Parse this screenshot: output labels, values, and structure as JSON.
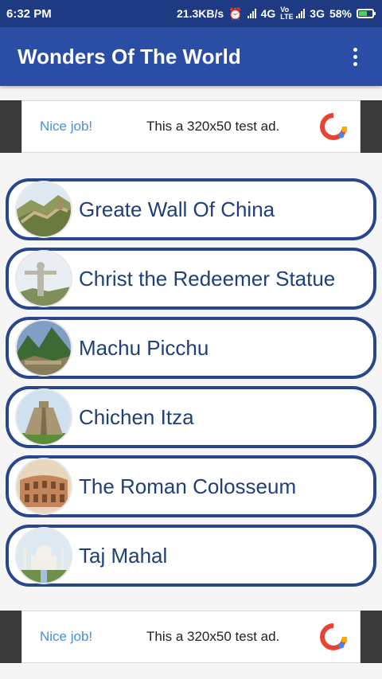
{
  "status_bar": {
    "time": "6:32 PM",
    "network_speed": "21.3KB/s",
    "network_4g": "4G",
    "volte": "Vo LTE",
    "network_3g": "3G",
    "battery": "58%"
  },
  "app_bar": {
    "title": "Wonders Of The World"
  },
  "ads": [
    {
      "nice": "Nice job!",
      "text": "This a 320x50 test ad."
    },
    {
      "nice": "Nice job!",
      "text": "This a 320x50 test ad."
    }
  ],
  "wonders": [
    {
      "label": "Greate Wall Of China",
      "icon": "great-wall-icon"
    },
    {
      "label": "Christ the Redeemer Statue",
      "icon": "christ-redeemer-icon"
    },
    {
      "label": "Machu Picchu",
      "icon": "machu-picchu-icon"
    },
    {
      "label": "Chichen Itza",
      "icon": "chichen-itza-icon"
    },
    {
      "label": "The Roman Colosseum",
      "icon": "colosseum-icon"
    },
    {
      "label": "Taj Mahal",
      "icon": "taj-mahal-icon"
    }
  ],
  "colors": {
    "status_bar": "#1e3a82",
    "app_bar": "#2a4ea6",
    "card_border": "#28468d",
    "card_text": "#1f3f7a",
    "ad_link": "#4a8de0"
  }
}
